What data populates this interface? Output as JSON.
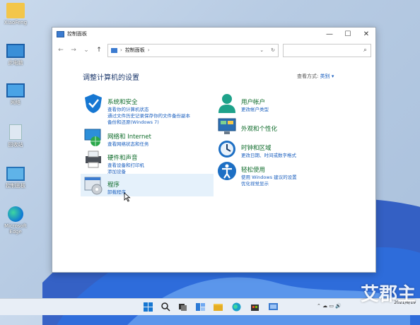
{
  "desktop": {
    "icons": [
      {
        "label": "XiaoFeng"
      },
      {
        "label": "此电脑"
      },
      {
        "label": "网络"
      },
      {
        "label": "回收站"
      },
      {
        "label": "控制面板"
      },
      {
        "label": "Microsoft Edge"
      }
    ]
  },
  "window": {
    "title": "控制面板",
    "controls": {
      "minimize": "—",
      "maximize": "☐",
      "close": "✕"
    },
    "nav": {
      "back": "←",
      "forward": "→",
      "dropdown": "⌄",
      "up": "↑"
    },
    "address": {
      "crumb": "控制面板",
      "sep1": "›",
      "sep2": "›",
      "dropdown": "⌄",
      "refresh": "↻"
    },
    "search_icon": "⌕"
  },
  "control_panel": {
    "heading": "调整计算机的设置",
    "view_by_label": "查看方式:",
    "view_by_value": "类别 ▾",
    "categories_left": [
      {
        "icon": "shield-icon",
        "title": "系统和安全",
        "links": [
          "查看你的计算机状态",
          "通过文件历史记录保存你的文件备份副本",
          "备份和还原(Windows 7)"
        ]
      },
      {
        "icon": "network-icon",
        "title": "网络和 Internet",
        "links": [
          "查看网络状态和任务"
        ]
      },
      {
        "icon": "printer-icon",
        "title": "硬件和声音",
        "links": [
          "查看设备和打印机",
          "添加设备"
        ]
      },
      {
        "icon": "programs-icon",
        "title": "程序",
        "links": [
          "卸载程序"
        ]
      }
    ],
    "categories_right": [
      {
        "icon": "user-icon",
        "title": "用户帐户",
        "links": [
          "更改帐户类型"
        ]
      },
      {
        "icon": "appearance-icon",
        "title": "外观和个性化",
        "links": []
      },
      {
        "icon": "clock-icon",
        "title": "时钟和区域",
        "links": [
          "更改日期、时间或数字格式"
        ]
      },
      {
        "icon": "accessibility-icon",
        "title": "轻松使用",
        "links": [
          "使用 Windows 建议的设置",
          "优化视觉显示"
        ]
      }
    ]
  },
  "taskbar": {
    "clock_date": "2021/6/19",
    "tray": "⌃ ☁ ▭ 🔊"
  },
  "watermark": "艾郡主"
}
